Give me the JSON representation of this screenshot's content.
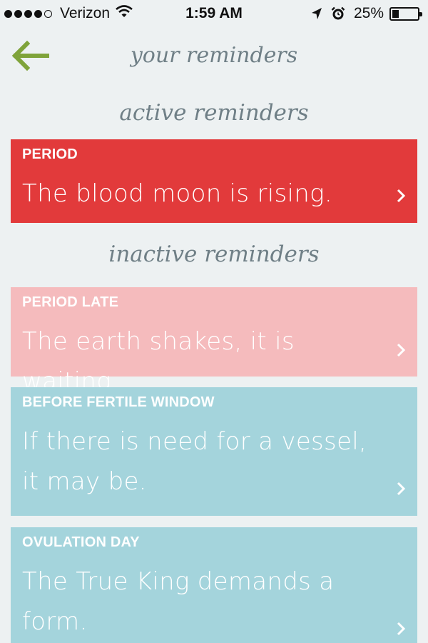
{
  "status_bar": {
    "carrier": "Verizon",
    "time": "1:59 AM",
    "battery": "25%",
    "battery_level": 0.25,
    "signal_bars": 4,
    "icons": [
      "wifi-icon",
      "location-arrow-icon",
      "alarm-icon",
      "battery-icon"
    ]
  },
  "header": {
    "back_icon": "back-arrow-icon",
    "title": "your reminders"
  },
  "sections": {
    "active_title": "active reminders",
    "inactive_title": "inactive reminders"
  },
  "reminders": {
    "period": {
      "label": "PERIOD",
      "message": "The blood moon is rising.",
      "color": "#e23a3b"
    },
    "period_late": {
      "label": "PERIOD LATE",
      "message": "The earth shakes, it is waiting.",
      "color": "#f5bbbd"
    },
    "before_fertile_window": {
      "label": "BEFORE FERTILE WINDOW",
      "message": "If there is need for a vessel, it may be.",
      "color": "#a4d4dc"
    },
    "ovulation_day": {
      "label": "OVULATION DAY",
      "message": "The True King demands a form.",
      "color": "#a4d4dc"
    }
  },
  "colors": {
    "background": "#edf1f2",
    "accent_green": "#7fa33a",
    "title_gray": "#6f7f86"
  }
}
